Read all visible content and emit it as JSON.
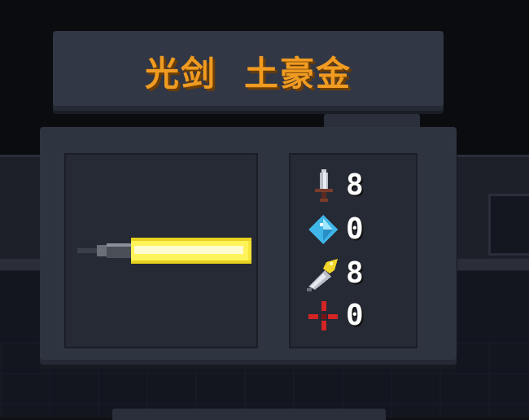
{
  "weapon": {
    "name": "光剑",
    "rarity": "土豪金",
    "icon": "lightsaber-icon",
    "blade_color": "#ffea3b",
    "title_color": "#f09b21"
  },
  "stats": [
    {
      "key": "damage",
      "icon": "sword-icon",
      "value": "8"
    },
    {
      "key": "energy",
      "icon": "diamond-icon",
      "value": "0"
    },
    {
      "key": "crit",
      "icon": "crit-icon",
      "value": "8"
    },
    {
      "key": "accuracy",
      "icon": "crosshair-icon",
      "value": "0"
    }
  ]
}
